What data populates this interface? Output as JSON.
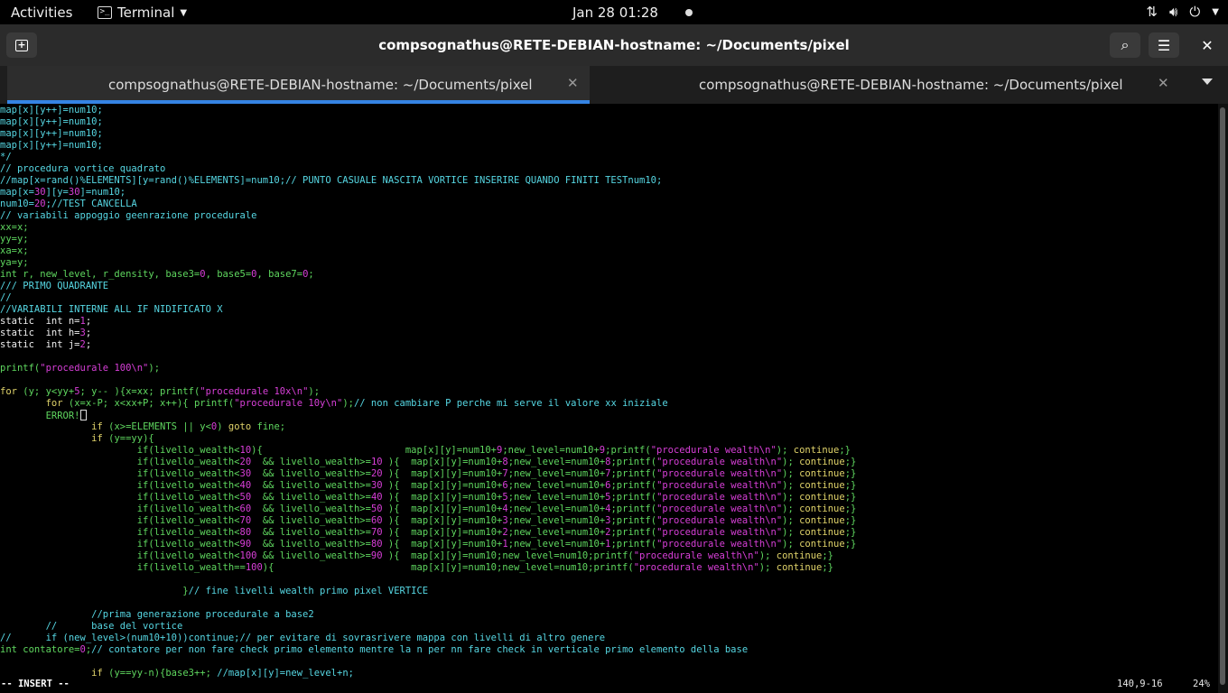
{
  "topbar": {
    "activities": "Activities",
    "app_name": "Terminal",
    "clock": "Jan 28  01:28"
  },
  "window": {
    "title": "compsognathus@RETE-DEBIAN-hostname: ~/Documents/pixel"
  },
  "tabs": [
    {
      "label": "compsognathus@RETE-DEBIAN-hostname: ~/Documents/pixel",
      "active": true
    },
    {
      "label": "compsognathus@RETE-DEBIAN-hostname: ~/Documents/pixel",
      "active": false
    }
  ],
  "editor": {
    "mode": "-- INSERT --",
    "position": "140,9-16",
    "percent": "24%",
    "lines": [
      [
        [
          "map[x][y++]=num10;",
          "cm"
        ]
      ],
      [
        [
          "map[x][y++]=num10;",
          "cm"
        ]
      ],
      [
        [
          "map[x][y++]=num10;",
          "cm"
        ]
      ],
      [
        [
          "map[x][y++]=num10;",
          "cm"
        ]
      ],
      [
        [
          "*/",
          "cm"
        ]
      ],
      [
        [
          "// procedura vortice quadrato",
          "cm"
        ]
      ],
      [
        [
          "//map[x=rand()%ELEMENTS][y=rand()%ELEMENTS]=num10;// PUNTO CASUALE NASCITA VORTICE INSERIRE QUANDO FINITI TESTnum10;",
          "cm"
        ]
      ],
      [
        [
          "map[x=",
          "cm"
        ],
        [
          "30",
          "nu"
        ],
        [
          "][y=",
          "cm"
        ],
        [
          "30",
          "nu"
        ],
        [
          "]=num10;",
          "cm"
        ]
      ],
      [
        [
          "num10=",
          "cm"
        ],
        [
          "20",
          "nu"
        ],
        [
          ";",
          "cm"
        ],
        [
          "//TEST CANCELLA",
          "cm"
        ]
      ],
      [
        [
          "// variabili appoggio geenrazione procedurale",
          "cm"
        ]
      ],
      [
        [
          "xx=x;",
          "ty"
        ]
      ],
      [
        [
          "yy=y;",
          "ty"
        ]
      ],
      [
        [
          "xa=x;",
          "ty"
        ]
      ],
      [
        [
          "ya=y;",
          "ty"
        ]
      ],
      [
        [
          "int",
          "ty"
        ],
        [
          " r, new_level, r_density, base3=",
          "ty"
        ],
        [
          "0",
          "nu"
        ],
        [
          ", base5=",
          "ty"
        ],
        [
          "0",
          "nu"
        ],
        [
          ", base7=",
          "ty"
        ],
        [
          "0",
          "nu"
        ],
        [
          ";",
          "ty"
        ]
      ],
      [
        [
          "/// PRIMO QUADRANTE",
          "cm"
        ]
      ],
      [
        [
          "//",
          "cm"
        ]
      ],
      [
        [
          "//VARIABILI INTERNE ALL IF NIDIFICATO X",
          "cm"
        ]
      ],
      [
        [
          "static  int n=",
          "er"
        ],
        [
          "1",
          "nu"
        ],
        [
          ";",
          "er"
        ]
      ],
      [
        [
          "static  int h=",
          "er"
        ],
        [
          "3",
          "nu"
        ],
        [
          ";",
          "er"
        ]
      ],
      [
        [
          "static  int j=",
          "er"
        ],
        [
          "2",
          "nu"
        ],
        [
          ";",
          "er"
        ]
      ],
      [
        [
          "",
          ""
        ]
      ],
      [
        [
          "printf(",
          "ty"
        ],
        [
          "\"procedurale 100\\n\"",
          "st"
        ],
        [
          ");",
          "ty"
        ]
      ],
      [
        [
          "",
          ""
        ]
      ],
      [
        [
          "for",
          "kw"
        ],
        [
          " (y; y<yy+",
          "ty"
        ],
        [
          "5",
          "nu"
        ],
        [
          "; y-- ){x=xx; printf(",
          "ty"
        ],
        [
          "\"procedurale 10x\\n\"",
          "st"
        ],
        [
          ");",
          "ty"
        ]
      ],
      [
        [
          "        for",
          "kw"
        ],
        [
          " (x=x-P; x<xx+P; x++){ printf(",
          "ty"
        ],
        [
          "\"procedurale 10y\\n\"",
          "st"
        ],
        [
          ");",
          "ty"
        ],
        [
          "// non cambiare P perche mi serve il valore xx iniziale",
          "cm"
        ]
      ],
      [
        [
          "        ERROR!",
          "ty"
        ],
        [
          "CURSOR",
          ""
        ]
      ],
      [
        [
          "                ",
          "er"
        ],
        [
          "if",
          "kw"
        ],
        [
          " (x>=ELEMENTS || y<",
          "ty"
        ],
        [
          "0",
          "nu"
        ],
        [
          ") ",
          "ty"
        ],
        [
          "goto",
          "kw"
        ],
        [
          " fine;",
          "ty"
        ]
      ],
      [
        [
          "                ",
          "er"
        ],
        [
          "if",
          "kw"
        ],
        [
          " (y==yy){",
          "ty"
        ]
      ],
      [
        [
          "                        if(livello_wealth<",
          "ty"
        ],
        [
          "10",
          "nu"
        ],
        [
          "){                         map[x][y]=num10+",
          "ty"
        ],
        [
          "9",
          "nu"
        ],
        [
          ";new_level=num10+",
          "ty"
        ],
        [
          "9",
          "nu"
        ],
        [
          ";printf(",
          "ty"
        ],
        [
          "\"procedurale wealth\\n\"",
          "st"
        ],
        [
          "); ",
          "ty"
        ],
        [
          "continue",
          "kw"
        ],
        [
          ";}",
          "ty"
        ]
      ],
      [
        [
          "                        if(livello_wealth<",
          "ty"
        ],
        [
          "20",
          "nu"
        ],
        [
          "  && livello_wealth>=",
          "ty"
        ],
        [
          "10",
          "nu"
        ],
        [
          " ){  map[x][y]=num10+",
          "ty"
        ],
        [
          "8",
          "nu"
        ],
        [
          ";new_level=num10+",
          "ty"
        ],
        [
          "8",
          "nu"
        ],
        [
          ";printf(",
          "ty"
        ],
        [
          "\"procedurale wealth\\n\"",
          "st"
        ],
        [
          "); ",
          "ty"
        ],
        [
          "continue",
          "kw"
        ],
        [
          ";}",
          "ty"
        ]
      ],
      [
        [
          "                        if(livello_wealth<",
          "ty"
        ],
        [
          "30",
          "nu"
        ],
        [
          "  && livello_wealth>=",
          "ty"
        ],
        [
          "20",
          "nu"
        ],
        [
          " ){  map[x][y]=num10+",
          "ty"
        ],
        [
          "7",
          "nu"
        ],
        [
          ";new_level=num10+",
          "ty"
        ],
        [
          "7",
          "nu"
        ],
        [
          ";printf(",
          "ty"
        ],
        [
          "\"procedurale wealth\\n\"",
          "st"
        ],
        [
          "); ",
          "ty"
        ],
        [
          "continue",
          "kw"
        ],
        [
          ";}",
          "ty"
        ]
      ],
      [
        [
          "                        if(livello_wealth<",
          "ty"
        ],
        [
          "40",
          "nu"
        ],
        [
          "  && livello_wealth>=",
          "ty"
        ],
        [
          "30",
          "nu"
        ],
        [
          " ){  map[x][y]=num10+",
          "ty"
        ],
        [
          "6",
          "nu"
        ],
        [
          ";new_level=num10+",
          "ty"
        ],
        [
          "6",
          "nu"
        ],
        [
          ";printf(",
          "ty"
        ],
        [
          "\"procedurale wealth\\n\"",
          "st"
        ],
        [
          "); ",
          "ty"
        ],
        [
          "continue",
          "kw"
        ],
        [
          ";}",
          "ty"
        ]
      ],
      [
        [
          "                        if(livello_wealth<",
          "ty"
        ],
        [
          "50",
          "nu"
        ],
        [
          "  && livello_wealth>=",
          "ty"
        ],
        [
          "40",
          "nu"
        ],
        [
          " ){  map[x][y]=num10+",
          "ty"
        ],
        [
          "5",
          "nu"
        ],
        [
          ";new_level=num10+",
          "ty"
        ],
        [
          "5",
          "nu"
        ],
        [
          ";printf(",
          "ty"
        ],
        [
          "\"procedurale wealth\\n\"",
          "st"
        ],
        [
          "); ",
          "ty"
        ],
        [
          "continue",
          "kw"
        ],
        [
          ";}",
          "ty"
        ]
      ],
      [
        [
          "                        if(livello_wealth<",
          "ty"
        ],
        [
          "60",
          "nu"
        ],
        [
          "  && livello_wealth>=",
          "ty"
        ],
        [
          "50",
          "nu"
        ],
        [
          " ){  map[x][y]=num10+",
          "ty"
        ],
        [
          "4",
          "nu"
        ],
        [
          ";new_level=num10+",
          "ty"
        ],
        [
          "4",
          "nu"
        ],
        [
          ";printf(",
          "ty"
        ],
        [
          "\"procedurale wealth\\n\"",
          "st"
        ],
        [
          "); ",
          "ty"
        ],
        [
          "continue",
          "kw"
        ],
        [
          ";}",
          "ty"
        ]
      ],
      [
        [
          "                        if(livello_wealth<",
          "ty"
        ],
        [
          "70",
          "nu"
        ],
        [
          "  && livello_wealth>=",
          "ty"
        ],
        [
          "60",
          "nu"
        ],
        [
          " ){  map[x][y]=num10+",
          "ty"
        ],
        [
          "3",
          "nu"
        ],
        [
          ";new_level=num10+",
          "ty"
        ],
        [
          "3",
          "nu"
        ],
        [
          ";printf(",
          "ty"
        ],
        [
          "\"procedurale wealth\\n\"",
          "st"
        ],
        [
          "); ",
          "ty"
        ],
        [
          "continue",
          "kw"
        ],
        [
          ";}",
          "ty"
        ]
      ],
      [
        [
          "                        if(livello_wealth<",
          "ty"
        ],
        [
          "80",
          "nu"
        ],
        [
          "  && livello_wealth>=",
          "ty"
        ],
        [
          "70",
          "nu"
        ],
        [
          " ){  map[x][y]=num10+",
          "ty"
        ],
        [
          "2",
          "nu"
        ],
        [
          ";new_level=num10+",
          "ty"
        ],
        [
          "2",
          "nu"
        ],
        [
          ";printf(",
          "ty"
        ],
        [
          "\"procedurale wealth\\n\"",
          "st"
        ],
        [
          "); ",
          "ty"
        ],
        [
          "continue",
          "kw"
        ],
        [
          ";}",
          "ty"
        ]
      ],
      [
        [
          "                        if(livello_wealth<",
          "ty"
        ],
        [
          "90",
          "nu"
        ],
        [
          "  && livello_wealth>=",
          "ty"
        ],
        [
          "80",
          "nu"
        ],
        [
          " ){  map[x][y]=num10+",
          "ty"
        ],
        [
          "1",
          "nu"
        ],
        [
          ";new_level=num10+",
          "ty"
        ],
        [
          "1",
          "nu"
        ],
        [
          ";printf(",
          "ty"
        ],
        [
          "\"procedurale wealth\\n\"",
          "st"
        ],
        [
          "); ",
          "ty"
        ],
        [
          "continue",
          "kw"
        ],
        [
          ";}",
          "ty"
        ]
      ],
      [
        [
          "                        if(livello_wealth<",
          "ty"
        ],
        [
          "100",
          "nu"
        ],
        [
          " && livello_wealth>=",
          "ty"
        ],
        [
          "90",
          "nu"
        ],
        [
          " ){  map[x][y]=num10;new_level=num10;printf(",
          "ty"
        ],
        [
          "\"procedurale wealth\\n\"",
          "st"
        ],
        [
          "); ",
          "ty"
        ],
        [
          "continue",
          "kw"
        ],
        [
          ";}",
          "ty"
        ]
      ],
      [
        [
          "                        if(livello_wealth==",
          "ty"
        ],
        [
          "100",
          "nu"
        ],
        [
          "){                        map[x][y]=num10;new_level=num10;printf(",
          "ty"
        ],
        [
          "\"procedurale wealth\\n\"",
          "st"
        ],
        [
          "); ",
          "ty"
        ],
        [
          "continue",
          "kw"
        ],
        [
          ";}",
          "ty"
        ]
      ],
      [
        [
          "",
          ""
        ]
      ],
      [
        [
          "                                }",
          "ty"
        ],
        [
          "// fine livelli wealth primo pixel VERTICE",
          "cm"
        ]
      ],
      [
        [
          "",
          ""
        ]
      ],
      [
        [
          "                ",
          "er"
        ],
        [
          "//prima generazione procedurale a base2",
          "cm"
        ]
      ],
      [
        [
          "        ",
          "er"
        ],
        [
          "//      base del vortice",
          "cm"
        ]
      ],
      [
        [
          "//      if (new_level>(num10+10))continue;// per evitare di sovrasrivere mappa con livelli di altro genere",
          "cm"
        ]
      ],
      [
        [
          "int",
          "ty"
        ],
        [
          " contatore=",
          "ty"
        ],
        [
          "0",
          "nu"
        ],
        [
          ";",
          "ty"
        ],
        [
          "// contatore per non fare check primo elemento mentre la n per nn fare check in verticale primo elemento della base",
          "cm"
        ]
      ],
      [
        [
          "",
          ""
        ]
      ],
      [
        [
          "                ",
          "er"
        ],
        [
          "if",
          "kw"
        ],
        [
          " (y==yy-n){base3++; ",
          "ty"
        ],
        [
          "//map[x][y]=new_level+n;",
          "cm"
        ]
      ]
    ]
  }
}
